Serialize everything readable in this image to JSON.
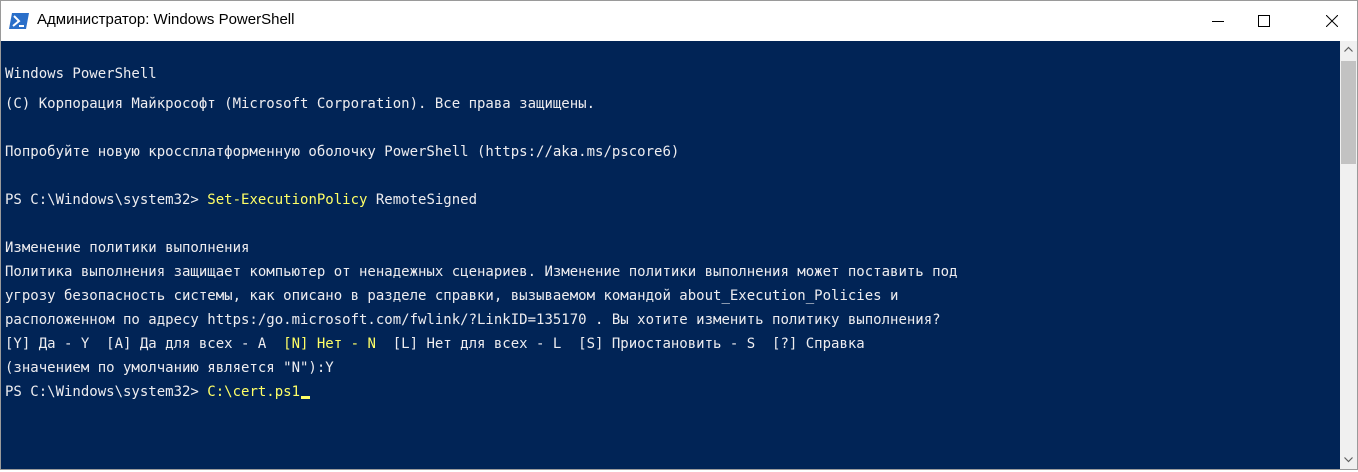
{
  "window": {
    "title": "Администратор: Windows PowerShell",
    "icon": "powershell-icon"
  },
  "controls": {
    "minimize_icon": "minimize-icon",
    "maximize_icon": "maximize-icon",
    "close_icon": "close-icon"
  },
  "console": {
    "banner1": "Windows PowerShell",
    "banner2": "(C) Корпорация Майкрософт (Microsoft Corporation). Все права защищены.",
    "hint": "Попробуйте новую кроссплатформенную оболочку PowerShell (https://aka.ms/pscore6)",
    "prompt1": "PS C:\\Windows\\system32> ",
    "cmd1_name": "Set-ExecutionPolicy",
    "cmd1_arg": " RemoteSigned",
    "policy_title": "Изменение политики выполнения",
    "policy_text1": "Политика выполнения защищает компьютер от ненадежных сценариев. Изменение политики выполнения может поставить под",
    "policy_text2": "угрозу безопасность системы, как описано в разделе справки, вызываемом командой about_Execution_Policies и",
    "policy_text3": "расположенном по адресу https:/go.microsoft.com/fwlink/?LinkID=135170 . Вы хотите изменить политику выполнения?",
    "choices_a": "[Y] Да - Y  [A] Да для всех - A  ",
    "choices_default": "[N] Нет - N",
    "choices_b": "  [L] Нет для всех - L  [S] Приостановить - S  [?] Справка",
    "default_line": "(значением по умолчанию является \"N\"):Y",
    "prompt2": "PS C:\\Windows\\system32> ",
    "cmd2": "C:\\cert.ps1"
  },
  "colors": {
    "background": "#012456",
    "text": "#eeedf0",
    "highlight": "#ffff66"
  }
}
